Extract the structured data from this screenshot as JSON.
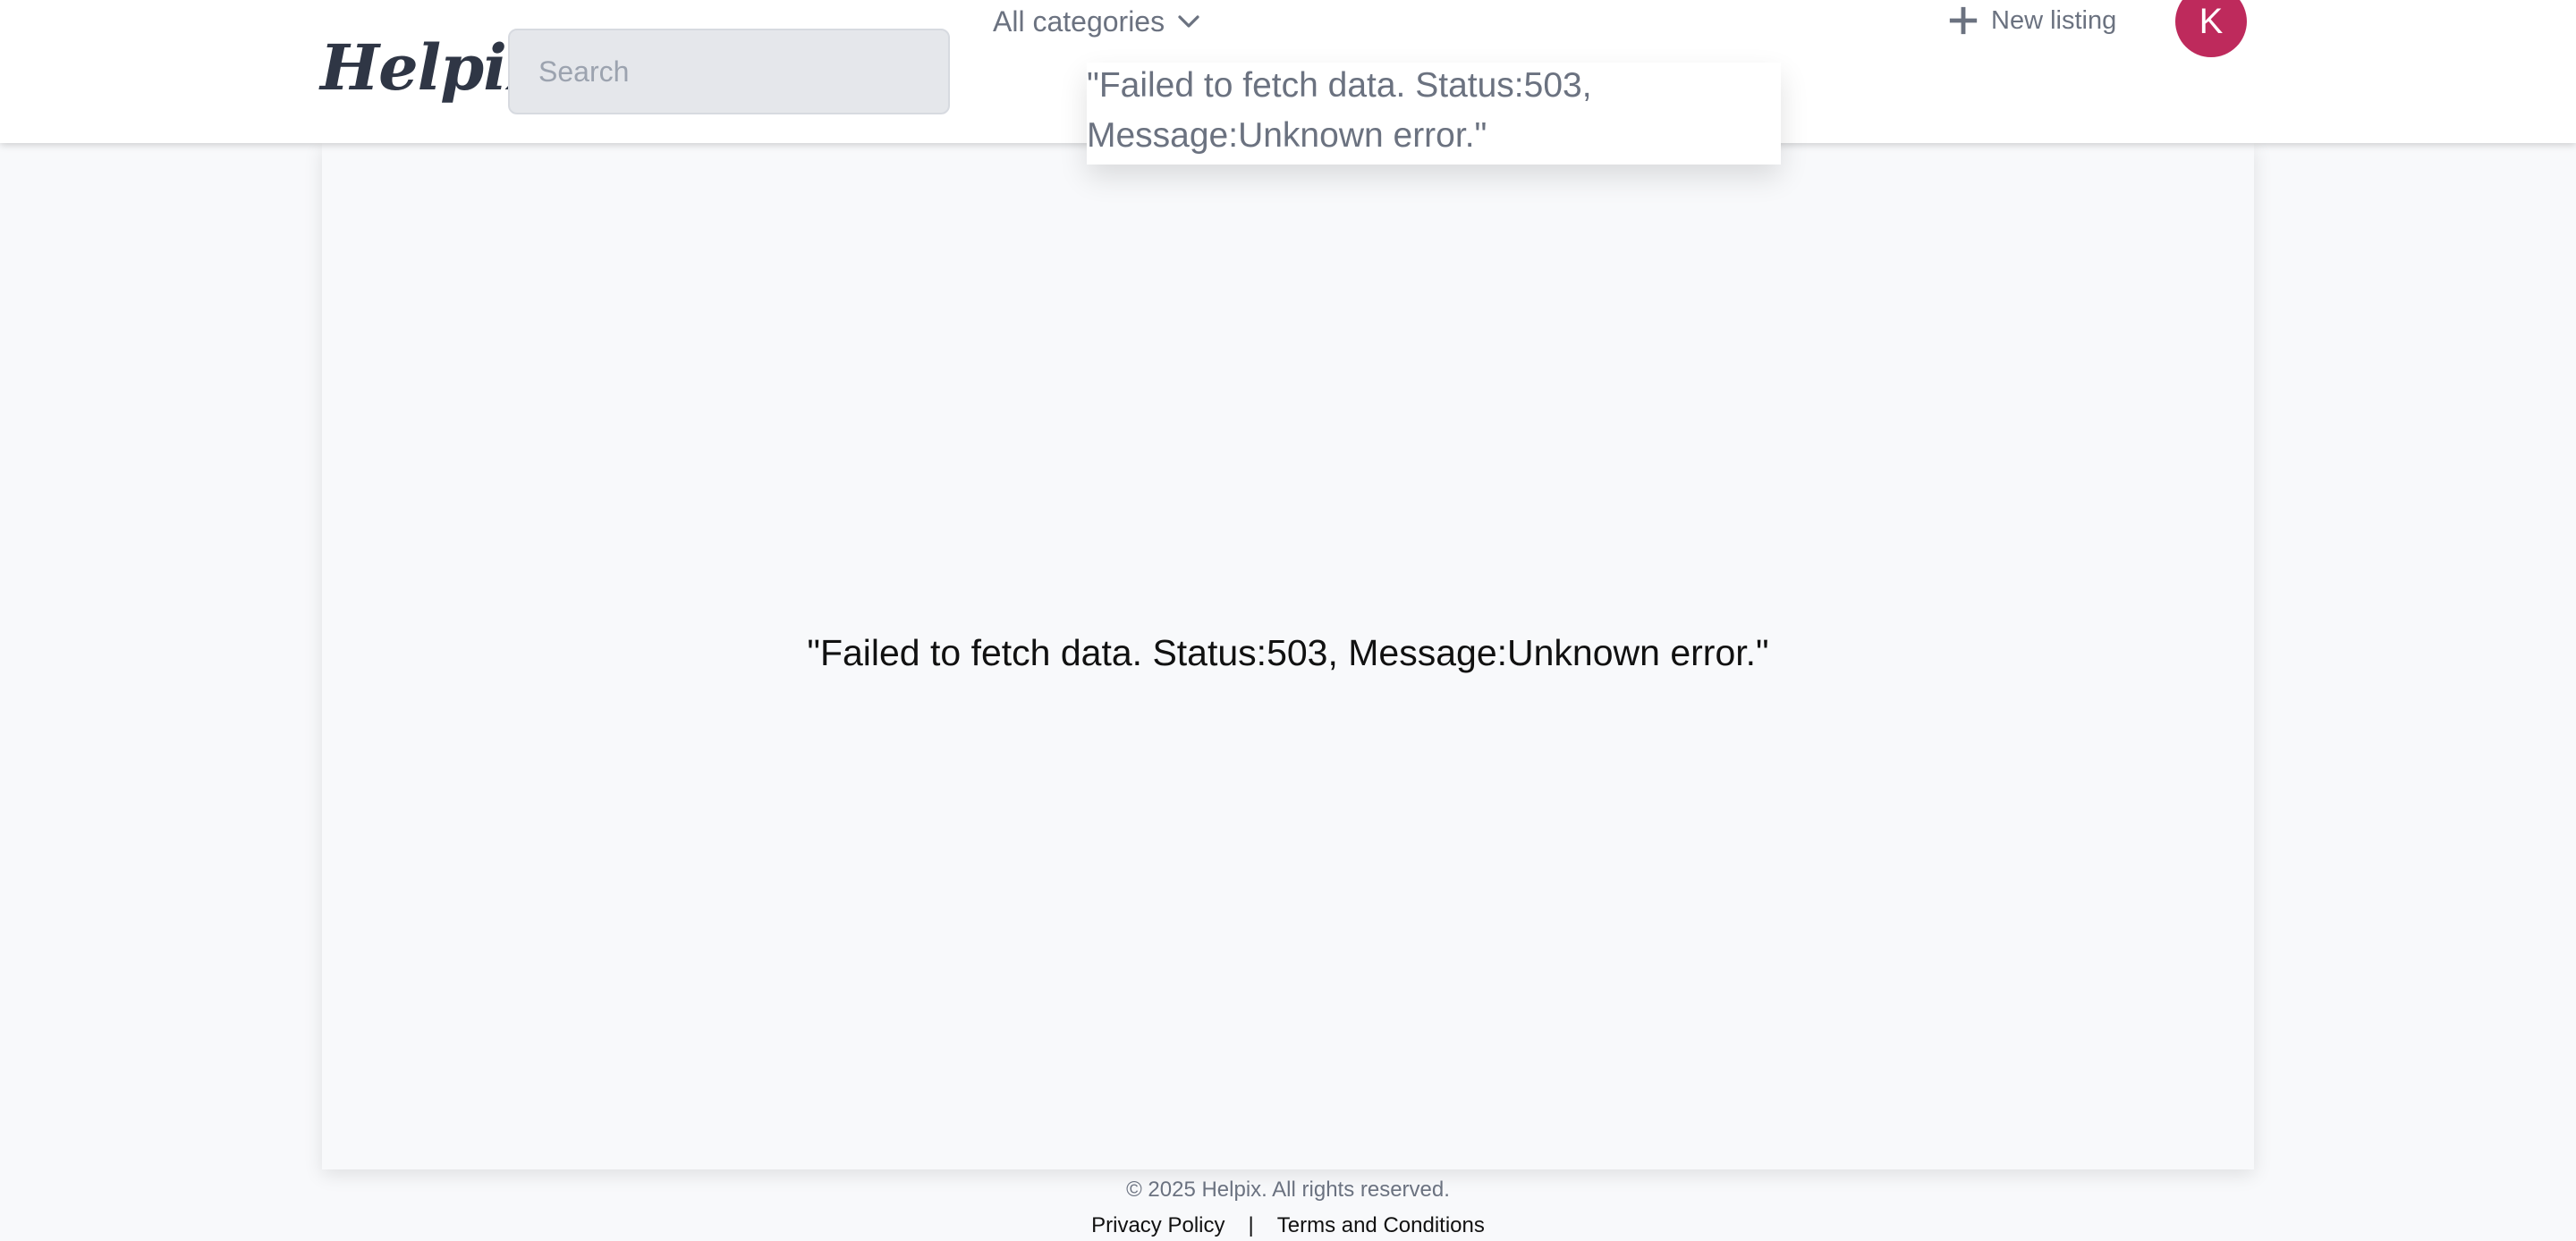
{
  "header": {
    "logo": "Helpix",
    "search": {
      "placeholder": "Search",
      "value": ""
    },
    "categories_label": "All categories",
    "new_listing_label": "New listing",
    "avatar_initial": "K"
  },
  "dropdown": {
    "message": "\"Failed to fetch data. Status:503, Message:Unknown error.\""
  },
  "main": {
    "error_message": "\"Failed to fetch data. Status:503, Message:Unknown error.\""
  },
  "footer": {
    "copyright": "© 2025 Helpix. All rights reserved.",
    "privacy": "Privacy Policy",
    "separator": "|",
    "terms": "Terms and Conditions"
  },
  "colors": {
    "avatar_bg": "#be2a5c",
    "header_bg": "#ffffff",
    "page_bg": "#f8f9fb",
    "muted_text": "#6b7280"
  },
  "icons": {
    "categories": "chevron-down-icon",
    "new_listing": "plus-icon"
  }
}
